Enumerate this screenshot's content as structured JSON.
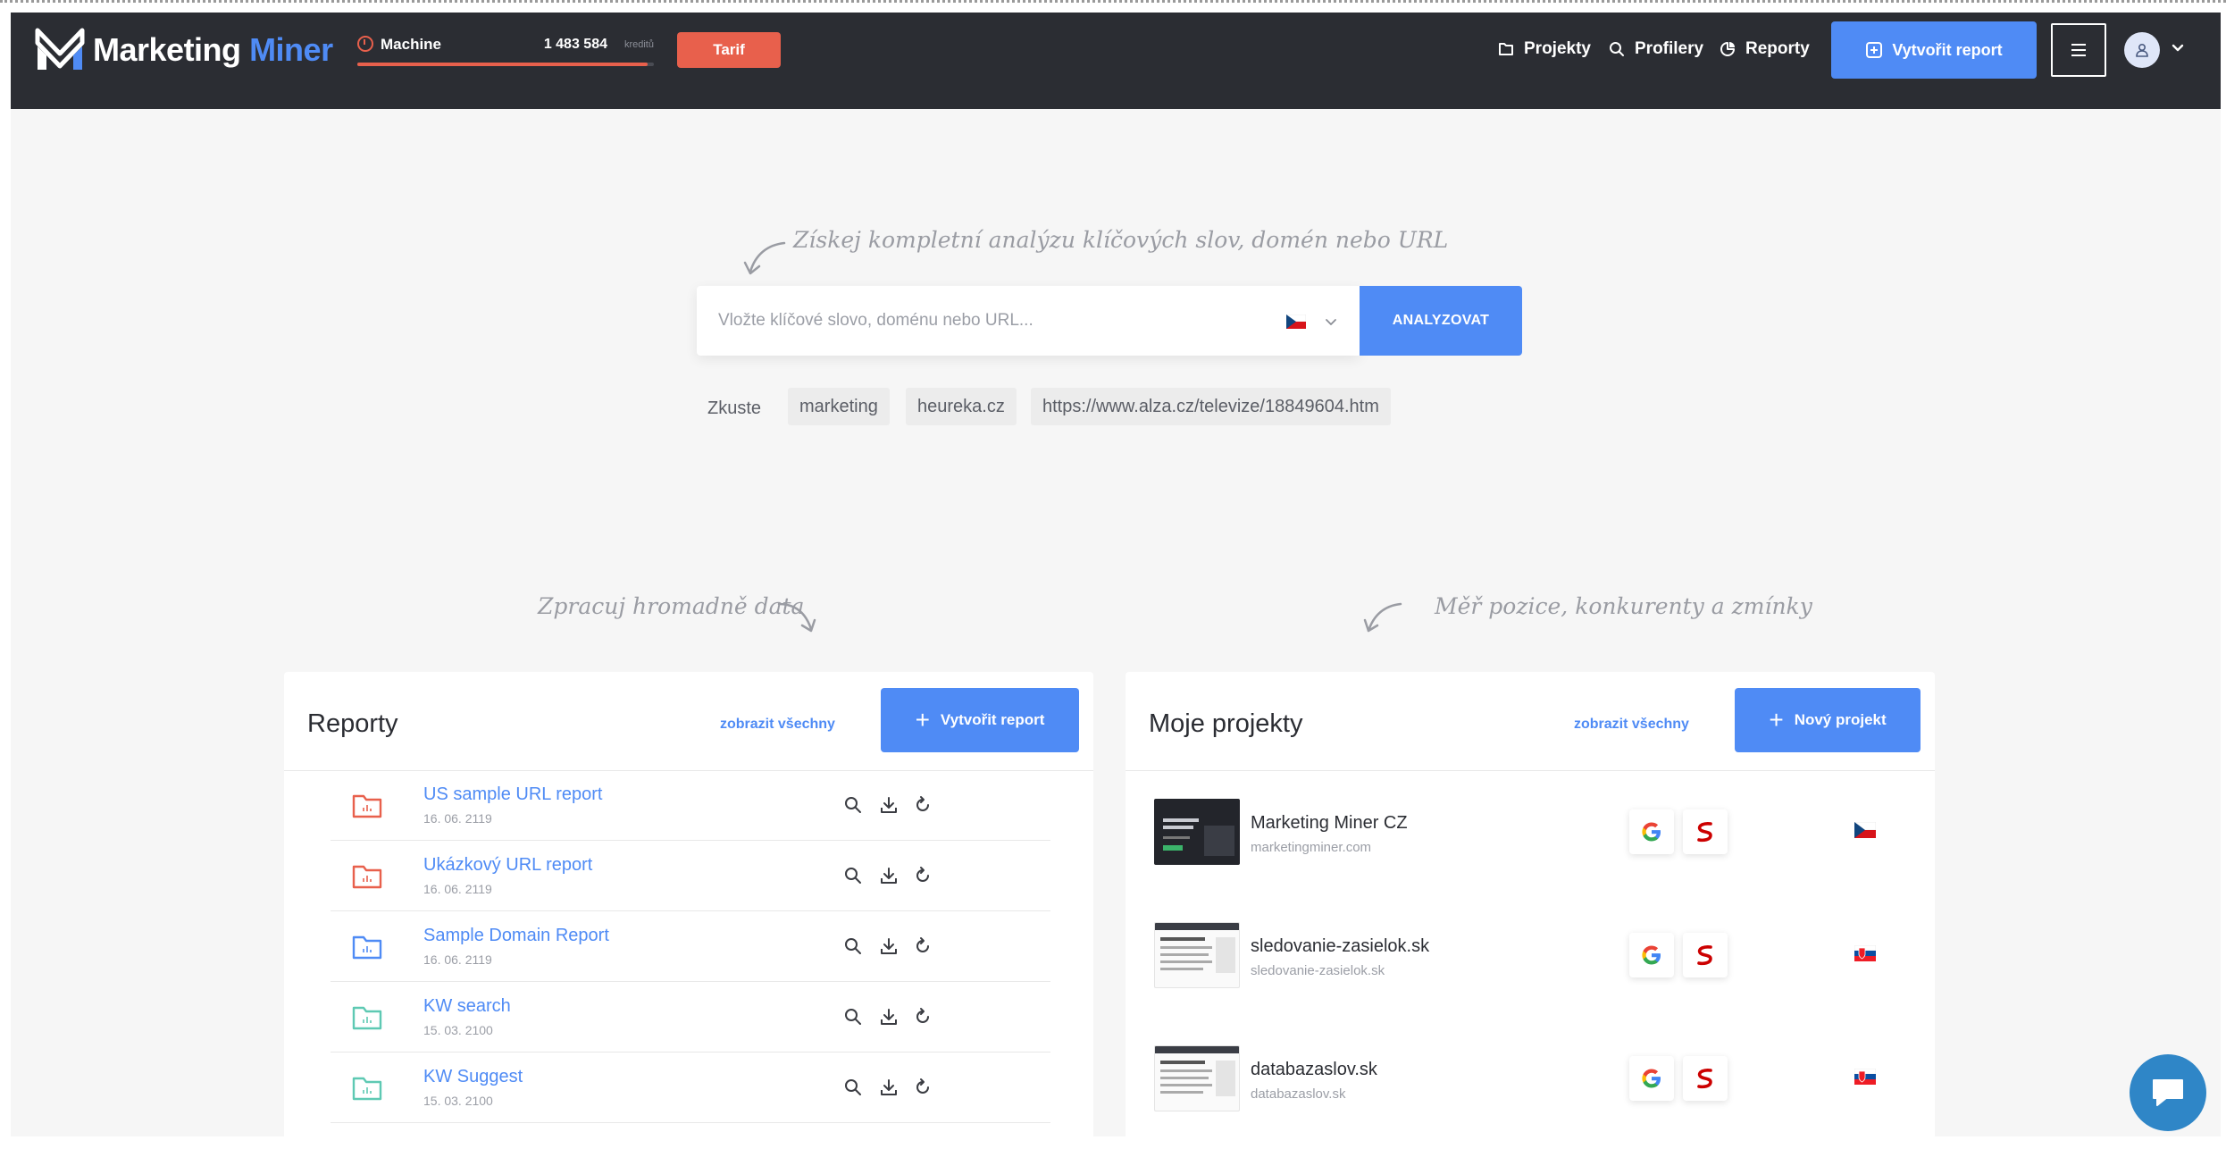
{
  "header": {
    "brand": {
      "word1": "Marketing",
      "word2": "Miner"
    },
    "credits": {
      "plan": "Machine",
      "amount": "1 483 584",
      "unit": "kreditů",
      "used_fraction": 0.98
    },
    "tarif_label": "Tarif",
    "nav": [
      {
        "label": "Projekty",
        "icon": "folder-icon"
      },
      {
        "label": "Profilery",
        "icon": "search-icon"
      },
      {
        "label": "Reporty",
        "icon": "pie-chart-icon"
      }
    ],
    "create_report_label": "Vytvořit report"
  },
  "hero": {
    "note": "Získej kompletní analýzu klíčových slov, domén nebo URL",
    "search_placeholder": "Vložte klíčové slovo, doménu nebo URL...",
    "search_value": "",
    "country": "CZ",
    "analyze_label": "ANALYZOVAT",
    "try_label": "Zkuste",
    "suggestions": [
      "marketing",
      "heureka.cz",
      "https://www.alza.cz/televize/18849604.htm"
    ]
  },
  "notes": {
    "left": "Zpracuj hromadně data",
    "right": "Měř pozice, konkurenty a zmínky"
  },
  "reports": {
    "title": "Reporty",
    "show_all": "zobrazit všechny",
    "create_label": "Vytvořit report",
    "items": [
      {
        "title": "US sample URL report",
        "date": "16. 06. 2119",
        "color": "#e8604c"
      },
      {
        "title": "Ukázkový URL report",
        "date": "16. 06. 2119",
        "color": "#e8604c"
      },
      {
        "title": "Sample Domain Report",
        "date": "16. 06. 2119",
        "color": "#4f8bf5"
      },
      {
        "title": "KW search",
        "date": "15. 03. 2100",
        "color": "#5ec9b3"
      },
      {
        "title": "KW Suggest",
        "date": "15. 03. 2100",
        "color": "#5ec9b3"
      }
    ]
  },
  "projects": {
    "title": "Moje projekty",
    "show_all": "zobrazit všechny",
    "create_label": "Nový projekt",
    "items": [
      {
        "name": "Marketing Miner CZ",
        "domain": "marketingminer.com",
        "country": "CZ"
      },
      {
        "name": "sledovanie-zasielok.sk",
        "domain": "sledovanie-zasielok.sk",
        "country": "SK"
      },
      {
        "name": "databazaslov.sk",
        "domain": "databazaslov.sk",
        "country": "SK"
      }
    ]
  },
  "colors": {
    "header_bg": "#2b2d33",
    "accent_blue": "#4f8bf5",
    "accent_orange": "#e8604c",
    "page_bg": "#f6f6f6",
    "chat": "#2f86c7"
  }
}
